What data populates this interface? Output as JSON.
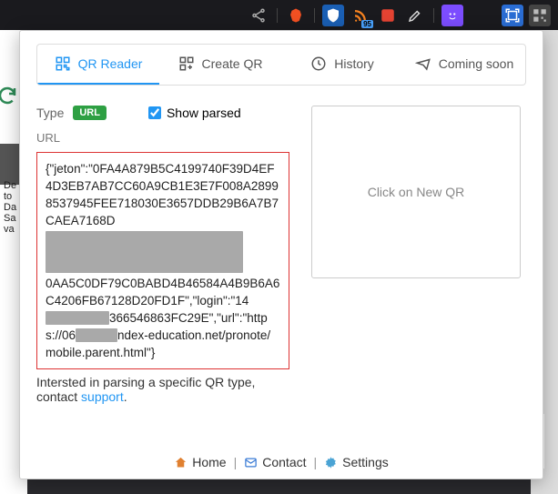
{
  "toolbar": {
    "rss_badge": "95"
  },
  "behind_text": "De\nto\nDa\nSa\nva",
  "tabs": [
    {
      "label": "QR Reader"
    },
    {
      "label": "Create QR"
    },
    {
      "label": "History"
    },
    {
      "label": "Coming soon"
    }
  ],
  "left": {
    "type_label": "Type",
    "type_badge": "URL",
    "show_parsed_label": "Show parsed",
    "url_heading": "URL",
    "payload": {
      "p1": "{\"jeton\":\"0FA4A879B5C4199740F39D4EF4D3EB7AB7CC60A9CB1E3E7F008A28998537945FEE718030E3657DDB29B6A7B7CAEA7168D",
      "p2": "0AA5C0DF79C0BABD4B46584A4B9B6A6C4206FB67128D20FD1F\",\"login\":\"14",
      "p3": "366546863FC29E\",\"url\":\"https://06",
      "p4": "ndex-education.net/pronote/mobile.parent.html\"}"
    }
  },
  "right": {
    "qr_placeholder": "Click on New QR"
  },
  "interest": {
    "text": "Intersted in parsing a specific QR type, contact ",
    "link": "support",
    "tail": "."
  },
  "footer": {
    "home": "Home",
    "contact": "Contact",
    "settings": "Settings"
  }
}
